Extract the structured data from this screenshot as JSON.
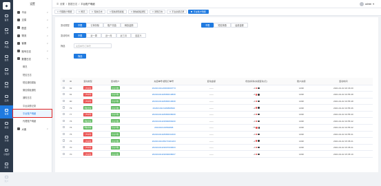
{
  "rail": [
    {
      "label": "首页",
      "icon": "home-icon"
    },
    {
      "label": "订单",
      "icon": "order-icon"
    },
    {
      "label": "商品",
      "icon": "goods-icon"
    },
    {
      "label": "会员",
      "icon": "member-icon"
    },
    {
      "label": "营销",
      "icon": "marketing-icon"
    },
    {
      "label": "数据",
      "icon": "data-icon"
    },
    {
      "label": "应用",
      "icon": "app-icon"
    },
    {
      "label": "设置",
      "icon": "settings-icon"
    },
    {
      "label": "渠道",
      "icon": "channel-icon"
    },
    {
      "label": "分销",
      "icon": "distribution-icon"
    },
    {
      "label": "小程序",
      "icon": "miniapp-icon"
    },
    {
      "label": "财务",
      "icon": "finance-icon"
    },
    {
      "label": "账户",
      "icon": "account-icon"
    }
  ],
  "sidebar": {
    "title": "设置",
    "groups": [
      {
        "label": "平台"
      },
      {
        "label": "交易"
      },
      {
        "label": "配送"
      },
      {
        "label": "物流"
      },
      {
        "label": "客服"
      },
      {
        "label": "账号日志"
      }
    ],
    "expanded_label": "数据日志",
    "sub_items": [
      "概况",
      "短信日志",
      "短信通知模板",
      "微信模板通知",
      "通知日志",
      "平台余额记录",
      "平台账户明细",
      "代理账户明细"
    ],
    "active_index": 6,
    "last_group": "大客"
  },
  "topbar": {
    "crumb_home": "设置",
    "crumb_parent": "数据日志",
    "crumb_current": "平台账户明细",
    "username": "admin"
  },
  "tabs": [
    "代理账户明细",
    "概况",
    "短信日志",
    "短信通知模板",
    "微信模板通知",
    "通知日志",
    "平台余额记录",
    "平台账户明细"
  ],
  "active_tab": 7,
  "filters": {
    "type_label": "变动类型",
    "type_options": [
      "不限",
      "订单扣除",
      "账户充值",
      "释放金额"
    ],
    "account_options": [
      "不限",
      "短信条数",
      "话费金额"
    ],
    "time_label": "变动时间",
    "time_options": [
      "不限",
      "近一周",
      "近一月",
      "近三月",
      "自定义"
    ],
    "search_label": "筛选",
    "search_placeholder": "充值单号/订单号",
    "search_button": "筛选"
  },
  "table": {
    "headers": [
      "ID",
      "变动类型",
      "变动账户",
      "充值单号/通知订单号",
      "变动金额",
      "增加/扣除/余额变动(元)",
      "账户余额",
      "变动时间"
    ],
    "rows": [
      {
        "id": "92",
        "type": "订单扣除",
        "type_color": "red",
        "account": "短信条数",
        "order": "20240101120000000773",
        "amount": "——",
        "change": "-4",
        "balance": "1498",
        "time": "2024-01-02 20:33:20"
      },
      {
        "id": "91",
        "type": "订单扣除",
        "type_color": "red",
        "account": "短信条数",
        "order": "20240101118680010808",
        "amount": "——",
        "change": "-4",
        "balance": "1498",
        "time": "2024-01-02 19:55:48"
      },
      {
        "id": "90",
        "type": "订单扣除",
        "type_color": "red",
        "account": "短信条数",
        "order": "20240101118680010608",
        "amount": "——",
        "change": "-4",
        "balance": "1498",
        "time": "2024-01-02 19:55:48"
      },
      {
        "id": "79",
        "type": "释放金额",
        "type_color": "green",
        "account": "短信条数",
        "order": "2024010113180868820",
        "amount": "——",
        "change": "-4",
        "balance": "1498",
        "time": "2024-01-02 19:55:46"
      },
      {
        "id": "77",
        "type": "订单扣除",
        "type_color": "red",
        "account": "短信条数",
        "order": "20240101118680008008",
        "amount": "——",
        "change": "-4",
        "balance": "1498",
        "time": "2024-01-02 19:55:40"
      },
      {
        "id": "76",
        "type": "释放金额",
        "type_color": "green",
        "account": "短信条数",
        "order": "20240101119584806200",
        "amount": "——",
        "change": "-4",
        "balance": "1498",
        "time": "2024-01-02 19:55:42"
      },
      {
        "id": "76",
        "type": "释放金额",
        "type_color": "green",
        "account": "短信条数",
        "order": "2024010119584808",
        "amount": "——",
        "change": "76",
        "balance": "1498",
        "time": "2024-01-02 19:55:42"
      },
      {
        "id": "75",
        "type": "订单扣除",
        "type_color": "red",
        "account": "短信条数",
        "order": "20240101118680032400",
        "amount": "——",
        "change": "-4",
        "balance": "1498",
        "time": "2024-01-02 19:55:41"
      },
      {
        "id": "75",
        "type": "订单扣除",
        "type_color": "red",
        "account": "短信条数",
        "order": "20240101105271901203",
        "amount": "——",
        "change": "-4",
        "balance": "1498",
        "time": "2024-01-02 15:35:21"
      },
      {
        "id": "70",
        "type": "订单扣除",
        "type_color": "red",
        "account": "短信条数",
        "order": "20240101119607000603",
        "amount": "——",
        "change": "-4",
        "balance": "1498",
        "time": "2024-01-02 15:35:21"
      },
      {
        "id": "70",
        "type": "订单扣除",
        "type_color": "red",
        "account": "短信条数",
        "order": "20240101119609008007",
        "amount": "——",
        "change": "-4",
        "balance": "1498",
        "time": "2024-01-02 15:35:19"
      }
    ]
  },
  "colors": {
    "accent": "#1f7ae0",
    "rail": "#2d3a4b",
    "red": "#e94b4b",
    "green": "#5cb85c"
  }
}
